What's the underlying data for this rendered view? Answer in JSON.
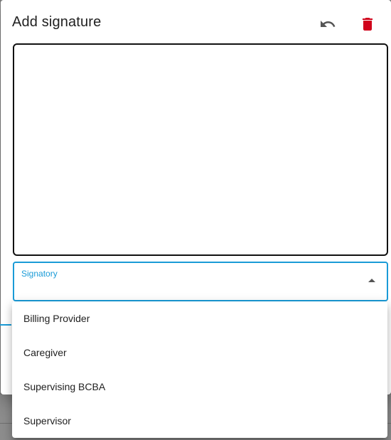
{
  "dialog": {
    "title": "Add signature",
    "undo_icon": "undo-icon",
    "delete_icon": "delete-icon",
    "colors": {
      "delete": "#d0021b",
      "accent": "#1a9bd7"
    }
  },
  "signatory": {
    "label": "Signatory",
    "value": "",
    "options": [
      "Billing Provider",
      "Caregiver",
      "Supervising BCBA",
      "Supervisor"
    ]
  }
}
